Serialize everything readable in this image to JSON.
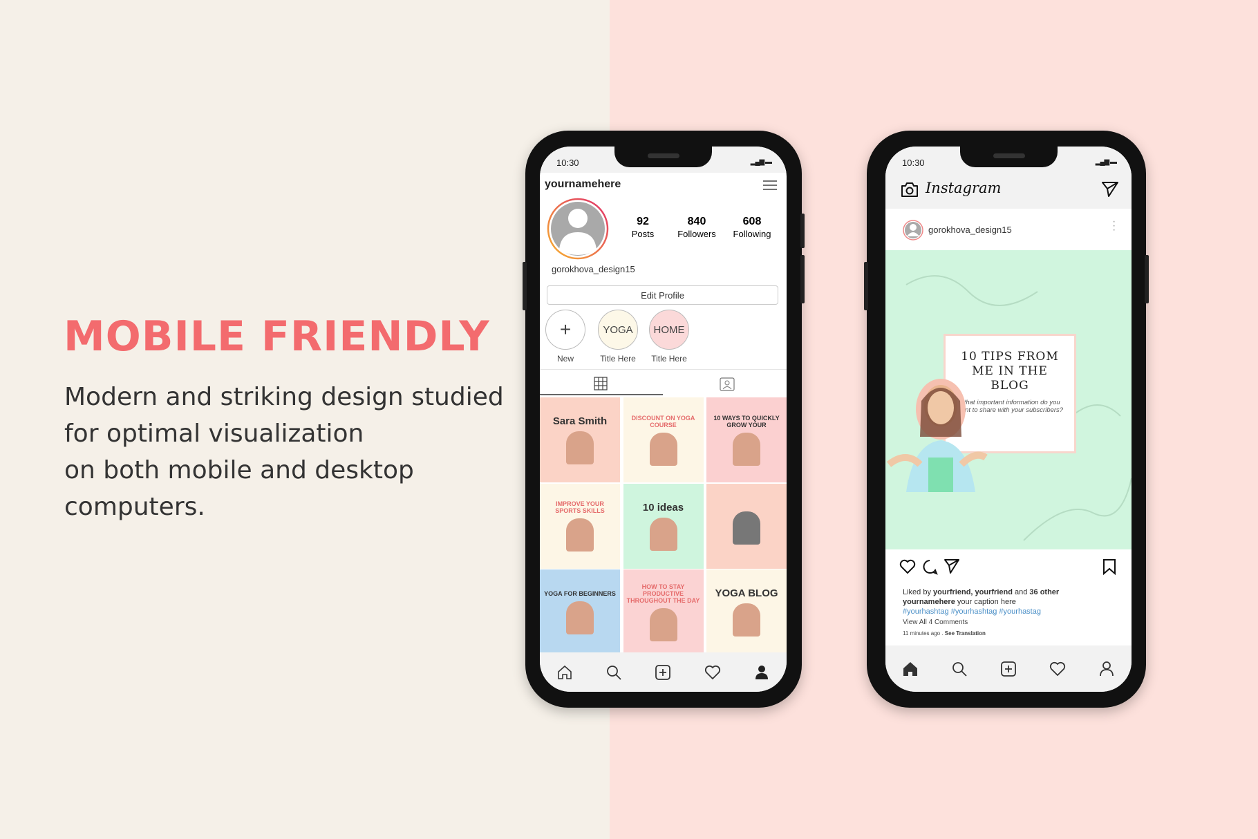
{
  "promo": {
    "headline": "MOBILE FRIENDLY",
    "body_lines": [
      "Modern and striking design studied",
      "for optimal visualization",
      "on both mobile and desktop",
      "computers."
    ]
  },
  "colors": {
    "accent": "#f36b6e",
    "left_bg": "#f5f0e8",
    "right_bg": "#fde1dc",
    "post_bg": "#d0f5de",
    "hashtag": "#4a8fc7"
  },
  "profile_phone": {
    "status_time": "10:30",
    "username_header": "yournamehere",
    "stats": [
      {
        "value": "92",
        "label": "Posts"
      },
      {
        "value": "840",
        "label": "Followers"
      },
      {
        "value": "608",
        "label": "Following"
      }
    ],
    "handle": "gorokhova_design15",
    "edit_profile": "Edit Profile",
    "highlights": [
      {
        "circle": "+",
        "label": "New"
      },
      {
        "circle": "YOGA",
        "label": "Title Here"
      },
      {
        "circle": "HOME",
        "label": "Title Here"
      }
    ],
    "tiles": [
      {
        "title": "Sara Smith",
        "bg": "#fbd3c6"
      },
      {
        "title": "DISCOUNT ON YOGA COURSE",
        "bg": "#fdf6e6"
      },
      {
        "title": "10 WAYS TO QUICKLY GROW YOUR",
        "bg": "#fbd0d0"
      },
      {
        "title": "IMPROVE YOUR SPORTS SKILLS",
        "bg": "#fdf6e6"
      },
      {
        "title": "10 ideas",
        "bg": "#cff5de"
      },
      {
        "title": "",
        "bg": "#fbd3c6"
      },
      {
        "title": "YOGA FOR BEGINNERS",
        "bg": "#b8d8f0"
      },
      {
        "title": "HOW TO STAY PRODUCTIVE THROUGHOUT THE DAY",
        "bg": "#fbd3d3"
      },
      {
        "title": "YOGA BLOG",
        "bg": "#fdf6e6"
      }
    ]
  },
  "feed_phone": {
    "status_time": "10:30",
    "app_title": "Instagram",
    "post_user": "gorokhova_design15",
    "post_card": {
      "title": "10 TIPS FROM ME IN THE BLOG",
      "subtitle": "What important information do you want to share with your subscribers?"
    },
    "likes": {
      "prefix": "Liked by ",
      "names": "yourfriend, yourfriend",
      "mid": " and ",
      "others": "36 other"
    },
    "caption": {
      "user": "yournamehere",
      "text": " your caption here"
    },
    "hashtags": "#yourhashtag #yourhashtag #yourhastag",
    "comments": "View All 4 Comments",
    "time": "11 minutes ago . ",
    "translation": "See Translation"
  }
}
